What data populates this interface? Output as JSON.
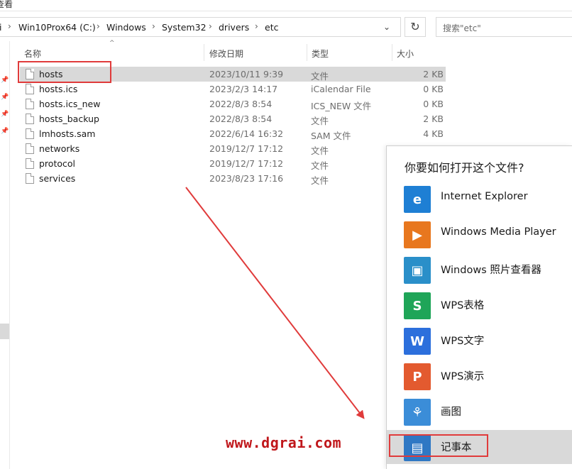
{
  "menu": {
    "partial_label": "查看"
  },
  "address": {
    "crumbs": [
      "Win10Prox64 (C:)",
      "Windows",
      "System32",
      "drivers",
      "etc"
    ],
    "separator": "›",
    "left_fragment": "i"
  },
  "search": {
    "placeholder": "搜索\"etc\""
  },
  "columns": {
    "name": "名称",
    "date": "修改日期",
    "type": "类型",
    "size": "大小"
  },
  "files": [
    {
      "name": "hosts",
      "date": "2023/10/11 9:39",
      "type": "文件",
      "size": "2 KB",
      "selected": true
    },
    {
      "name": "hosts.ics",
      "date": "2023/2/3 14:17",
      "type": "iCalendar File",
      "size": "0 KB"
    },
    {
      "name": "hosts.ics_new",
      "date": "2022/8/3 8:54",
      "type": "ICS_NEW 文件",
      "size": "0 KB"
    },
    {
      "name": "hosts_backup",
      "date": "2022/8/3 8:54",
      "type": "文件",
      "size": "2 KB"
    },
    {
      "name": "lmhosts.sam",
      "date": "2022/6/14 16:32",
      "type": "SAM 文件",
      "size": "4 KB"
    },
    {
      "name": "networks",
      "date": "2019/12/7 17:12",
      "type": "文件",
      "size": ""
    },
    {
      "name": "protocol",
      "date": "2019/12/7 17:12",
      "type": "文件",
      "size": ""
    },
    {
      "name": "services",
      "date": "2023/8/23 17:16",
      "type": "文件",
      "size": ""
    }
  ],
  "open_with": {
    "title": "你要如何打开这个文件?",
    "apps": [
      {
        "label": "Internet Explorer",
        "icon": "internet-explorer-icon",
        "color": "#1e7fd4"
      },
      {
        "label": "Windows Media Player",
        "icon": "media-player-icon",
        "color": "#e8771e"
      },
      {
        "label": "Windows 照片查看器",
        "icon": "photo-viewer-icon",
        "color": "#2a8fc9"
      },
      {
        "label": "WPS表格",
        "icon": "wps-sheet-icon",
        "color": "#1fa558"
      },
      {
        "label": "WPS文字",
        "icon": "wps-writer-icon",
        "color": "#2c6fdc"
      },
      {
        "label": "WPS演示",
        "icon": "wps-presentation-icon",
        "color": "#e35a2f"
      },
      {
        "label": "画图",
        "icon": "paint-icon",
        "color": "#3b8dd8"
      },
      {
        "label": "记事本",
        "icon": "notepad-icon",
        "color": "#2f78c4",
        "selected": true
      }
    ]
  },
  "watermark": "www.dgrai.com",
  "colors": {
    "highlight": "#e03b3b",
    "selection": "#d9d9d9",
    "watermark": "#c0171b"
  }
}
